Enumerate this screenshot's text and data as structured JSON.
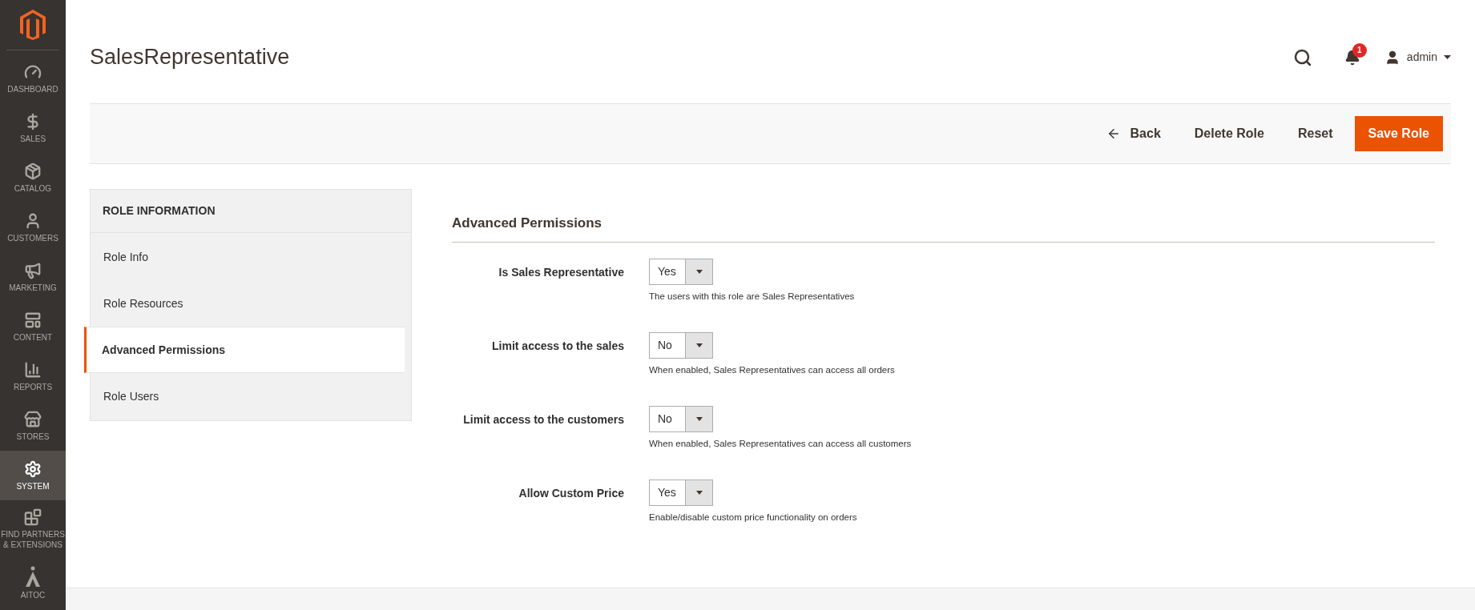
{
  "sidebar": {
    "items": [
      {
        "kind": "dashboard",
        "label": "DASHBOARD",
        "selected": false
      },
      {
        "kind": "sales",
        "label": "SALES",
        "selected": false
      },
      {
        "kind": "catalog",
        "label": "CATALOG",
        "selected": false
      },
      {
        "kind": "customers",
        "label": "CUSTOMERS",
        "selected": false
      },
      {
        "kind": "marketing",
        "label": "MARKETING",
        "selected": false
      },
      {
        "kind": "content",
        "label": "CONTENT",
        "selected": false
      },
      {
        "kind": "reports",
        "label": "REPORTS",
        "selected": false
      },
      {
        "kind": "stores",
        "label": "STORES",
        "selected": false
      },
      {
        "kind": "system",
        "label": "SYSTEM",
        "selected": true
      },
      {
        "kind": "partners",
        "label": "FIND PARTNERS & EXTENSIONS",
        "selected": false
      },
      {
        "kind": "aitoc",
        "label": "AITOC",
        "selected": false
      }
    ]
  },
  "header": {
    "title": "SalesRepresentative",
    "notification_count": "1",
    "user": "admin"
  },
  "actions": [
    {
      "kind": "back",
      "label": "Back"
    },
    {
      "kind": "plain",
      "label": "Delete Role"
    },
    {
      "kind": "plain",
      "label": "Reset"
    },
    {
      "kind": "primary",
      "label": "Save Role"
    }
  ],
  "tabs_panel": {
    "title": "ROLE INFORMATION",
    "tabs": [
      {
        "label": "Role Info",
        "selected": false
      },
      {
        "label": "Role Resources",
        "selected": false
      },
      {
        "label": "Advanced Permissions",
        "selected": true
      },
      {
        "label": "Role Users",
        "selected": false
      }
    ]
  },
  "form": {
    "title": "Advanced Permissions",
    "fields": [
      {
        "label": "Is Sales Representative",
        "value": "Yes",
        "note": "The users with this role are Sales Representatives"
      },
      {
        "label": "Limit access to the sales",
        "value": "No",
        "note": "When enabled, Sales Representatives can access all orders"
      },
      {
        "label": "Limit access to the customers",
        "value": "No",
        "note": "When enabled, Sales Representatives can access all customers"
      },
      {
        "label": "Allow Custom Price",
        "value": "Yes",
        "note": "Enable/disable custom price functionality on orders"
      }
    ]
  }
}
